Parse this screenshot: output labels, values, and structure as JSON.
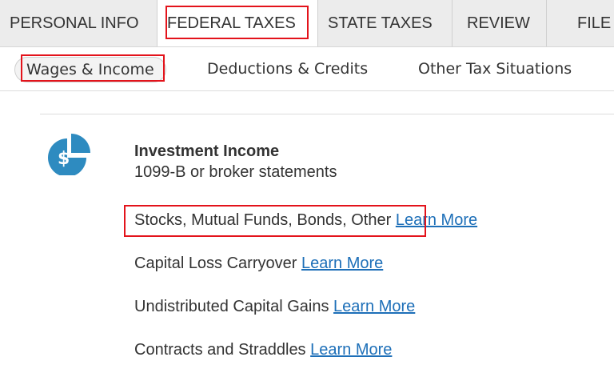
{
  "top_tabs": {
    "personal_info": "PERSONAL INFO",
    "federal_taxes": "FEDERAL TAXES",
    "state_taxes": "STATE TAXES",
    "review": "REVIEW",
    "file": "FILE"
  },
  "sub_tabs": {
    "wages_income": "Wages & Income",
    "deductions_credits": "Deductions & Credits",
    "other_tax_situations": "Other Tax Situations"
  },
  "section": {
    "icon": "pie-chart-dollar-icon",
    "title": "Investment Income",
    "subtitle": "1099-B or broker statements",
    "items": [
      {
        "label": "Stocks, Mutual Funds, Bonds, Other",
        "link": "Learn More"
      },
      {
        "label": "Capital Loss Carryover",
        "link": "Learn More"
      },
      {
        "label": "Undistributed Capital Gains",
        "link": "Learn More"
      },
      {
        "label": "Contracts and Straddles",
        "link": "Learn More"
      }
    ]
  },
  "colors": {
    "highlight": "#e3131b",
    "link": "#1d6fb8",
    "icon": "#2e8bc0"
  }
}
